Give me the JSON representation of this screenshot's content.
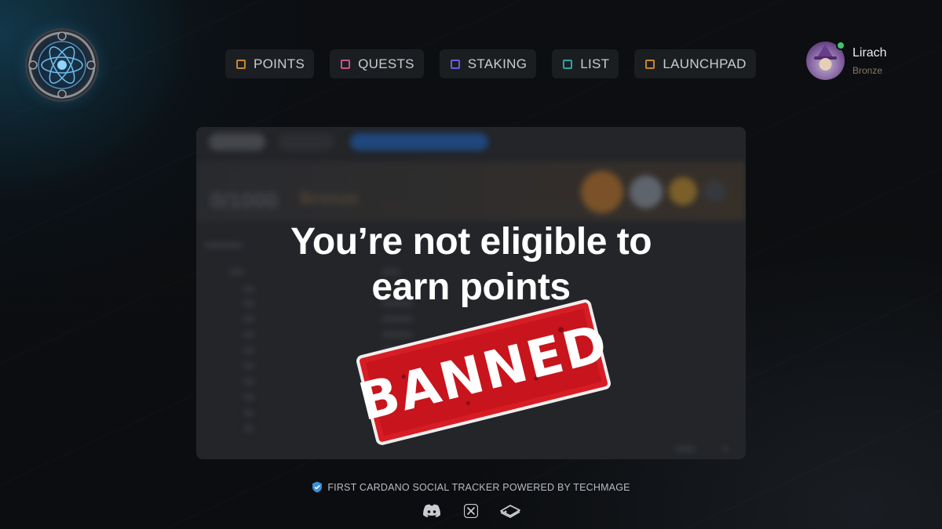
{
  "nav": {
    "items": [
      {
        "label": "POINTS",
        "color": "#c8862e",
        "icon": "square-icon"
      },
      {
        "label": "QUESTS",
        "color": "#c8568a",
        "icon": "square-icon"
      },
      {
        "label": "STAKING",
        "color": "#6a5ed8",
        "icon": "square-icon"
      },
      {
        "label": "LIST",
        "color": "#2aa6a0",
        "icon": "square-icon"
      },
      {
        "label": "LAUNCHPAD",
        "color": "#c8862e",
        "icon": "square-icon"
      }
    ]
  },
  "profile": {
    "name": "Lirach",
    "rank": "Bronze",
    "status_color": "#3ec96b"
  },
  "panel": {
    "headline_line1": "You’re not eligible to",
    "headline_line2": "earn points",
    "stamp_text": "BANNED",
    "blurred_points": "0/1000",
    "blurred_rank": "Bronze"
  },
  "footer": {
    "tagline": "FIRST CARDANO SOCIAL TRACKER POWERED BY TECHMAGE",
    "icons": [
      "discord-icon",
      "x-icon",
      "gitbook-icon"
    ]
  },
  "colors": {
    "accent_red": "#d71d24",
    "background": "#0c0e11"
  }
}
